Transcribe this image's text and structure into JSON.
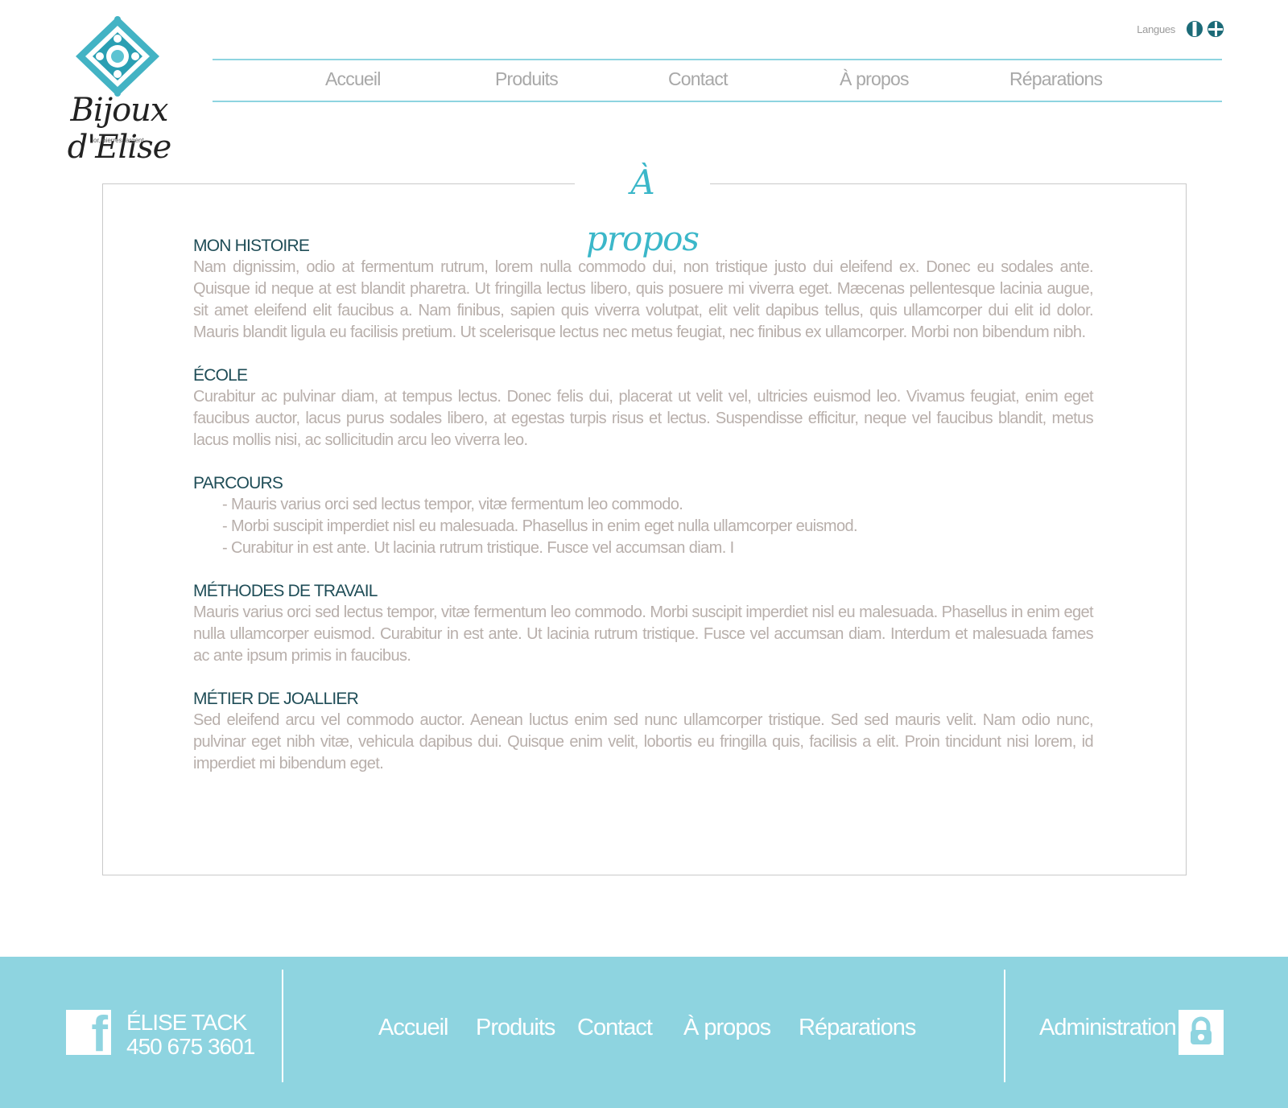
{
  "brand": {
    "name": "Bijoux d'Elise",
    "tagline": "or, pierres, argent"
  },
  "languages": {
    "label": "Langues",
    "options": [
      "fr-flag-icon",
      "uk-flag-icon"
    ]
  },
  "nav": {
    "items": [
      "Accueil",
      "Produits",
      "Contact",
      "À propos",
      "Réparations"
    ]
  },
  "page": {
    "title": "À propos"
  },
  "sections": [
    {
      "heading": "MON HISTOIRE",
      "text": "Nam dignissim, odio at fermentum rutrum, lorem nulla commodo dui, non tristique justo dui eleifend ex. Donec eu sodales ante. Quisque id neque at est blandit pharetra. Ut fringilla lectus libero, quis posuere mi viverra eget. Mæcenas pellentesque lacinia augue, sit amet eleifend elit faucibus a. Nam finibus, sapien quis viverra volutpat, elit velit dapibus tellus, quis ullamcorper dui elit id dolor. Mauris blandit ligula eu facilisis pretium. Ut scelerisque lectus nec metus feugiat, nec finibus ex ullamcorper. Morbi non bibendum nibh."
    },
    {
      "heading": "ÉCOLE",
      "text": "Curabitur ac pulvinar diam, at tempus lectus. Donec felis dui, placerat ut velit vel, ultricies euismod leo. Vivamus feugiat, enim eget faucibus auctor, lacus purus sodales libero, at egestas turpis risus et lectus. Suspendisse efficitur, neque vel faucibus blandit, metus lacus mollis nisi, ac sollicitudin arcu leo viverra leo."
    },
    {
      "heading": "PARCOURS",
      "items": [
        "- Mauris varius orci sed lectus tempor, vitæ fermentum leo commodo.",
        "- Morbi suscipit imperdiet nisl eu malesuada. Phasellus in enim eget nulla ullamcorper euismod.",
        "- Curabitur in est ante. Ut lacinia rutrum tristique. Fusce vel accumsan diam. I"
      ]
    },
    {
      "heading": "MÉTHODES DE TRAVAIL",
      "text": "Mauris varius orci sed lectus tempor, vitæ fermentum leo commodo. Morbi suscipit imperdiet nisl eu malesuada. Phasellus in enim eget nulla ullamcorper euismod. Curabitur in est ante. Ut lacinia rutrum tristique. Fusce vel accumsan diam. Interdum et malesuada fames ac ante ipsum primis in faucibus."
    },
    {
      "heading": "MÉTIER DE JOALLIER",
      "text": "Sed eleifend arcu vel commodo auctor. Aenean luctus enim sed nunc ullamcorper tristique. Sed sed mauris velit. Nam odio nunc, pulvinar eget nibh vitæ, vehicula dapibus dui. Quisque enim velit, lobortis eu fringilla quis, facilisis a elit. Proin tincidunt nisi lorem, id imperdiet mi bibendum eget."
    }
  ],
  "footer": {
    "contact_name": "ÉLISE TACK",
    "contact_phone": "450 675 3601",
    "nav": [
      "Accueil",
      "Produits",
      "Contact",
      "À propos",
      "Réparations"
    ],
    "admin_label": "Administration"
  },
  "colors": {
    "accent": "#8ed4e0",
    "title": "#3bb7c9",
    "heading": "#1f4d57",
    "body_text": "#b8afab"
  }
}
